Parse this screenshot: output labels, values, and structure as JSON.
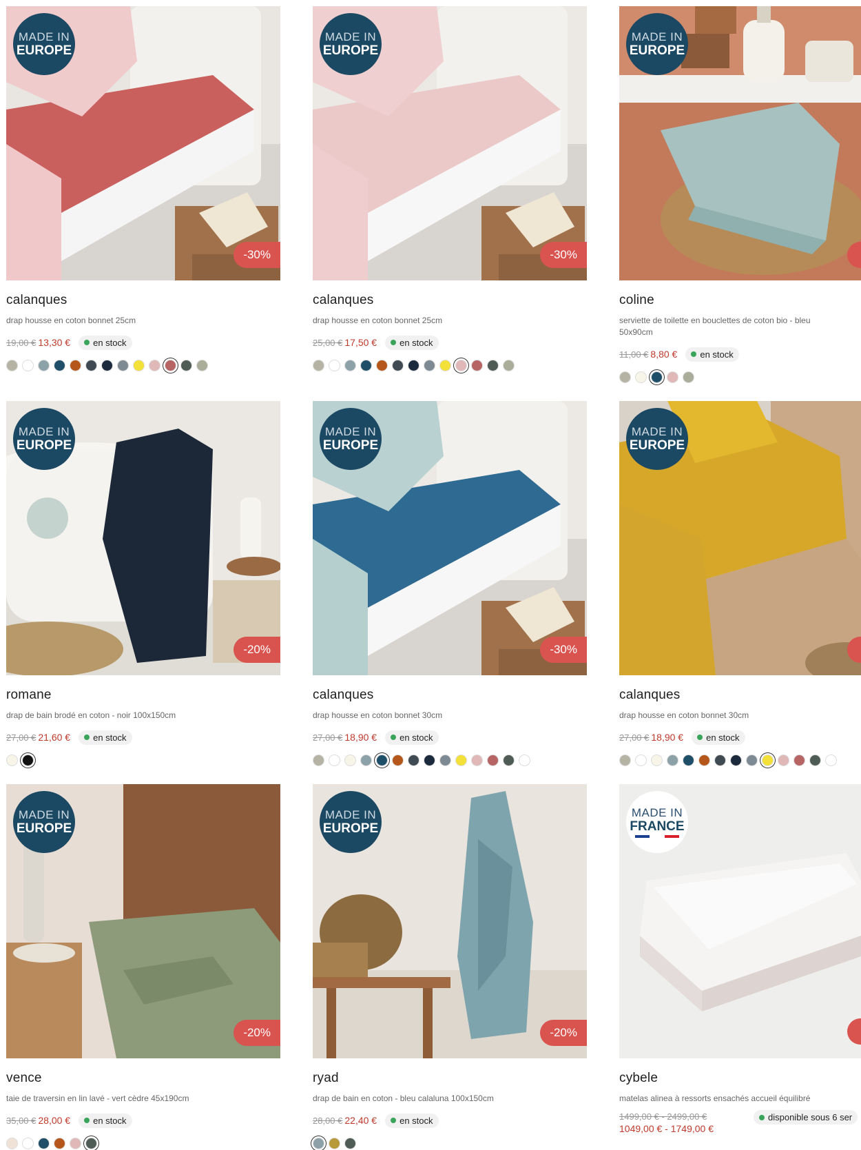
{
  "products": [
    {
      "id": "p1",
      "name": "calanques",
      "desc": "drap housse en coton bonnet 25cm",
      "old": "19,00 €",
      "new": "13,30 €",
      "stock": "en stock",
      "badge": {
        "l1": "MADE IN",
        "l2": "EUROPE"
      },
      "discount": "-30%",
      "swatches": [
        "#b5b3a3",
        "#ffffff",
        "#8da2a8",
        "#1f4e68",
        "#b5561a",
        "#3f4a52",
        "#1c2a3e",
        "#7e8a93",
        "#f3e13a",
        "#e0b8b8",
        "#b76464",
        "#4f5b55",
        "#a9ad9a"
      ],
      "selected": 10,
      "scene": "bed-red"
    },
    {
      "id": "p2",
      "name": "calanques",
      "desc": "drap housse en coton bonnet 25cm",
      "old": "25,00 €",
      "new": "17,50 €",
      "stock": "en stock",
      "badge": {
        "l1": "MADE IN",
        "l2": "EUROPE"
      },
      "discount": "-30%",
      "swatches": [
        "#b5b3a3",
        "#ffffff",
        "#8da2a8",
        "#1f4e68",
        "#b5561a",
        "#3f4a52",
        "#1c2a3e",
        "#7e8a93",
        "#f3e13a",
        "#e0b8b8",
        "#b76464",
        "#4f5b55",
        "#a9ad9a"
      ],
      "selected": 9,
      "scene": "bed-pink"
    },
    {
      "id": "p3",
      "name": "coline",
      "desc": "serviette de toilette en bouclettes de coton bio - bleu 50x90cm",
      "old": "11,00 €",
      "new": "8,80 €",
      "stock": "en stock",
      "badge": {
        "l1": "MADE IN",
        "l2": "EUROPE"
      },
      "discount": "",
      "swatches": [
        "#b5b3a3",
        "#f7f4e8",
        "#1f4e68",
        "#e0b8b8",
        "#a9ad9a"
      ],
      "selected": 2,
      "scene": "towel-blue"
    },
    {
      "id": "p4",
      "name": "romane",
      "desc": "drap de bain brodé en coton - noir 100x150cm",
      "old": "27,00 €",
      "new": "21,60 €",
      "stock": "en stock",
      "badge": {
        "l1": "MADE IN",
        "l2": "EUROPE"
      },
      "discount": "-20%",
      "swatches": [
        "#f7f4e8",
        "#111111"
      ],
      "selected": 1,
      "scene": "bath-black"
    },
    {
      "id": "p5",
      "name": "calanques",
      "desc": "drap housse en coton bonnet 30cm",
      "old": "27,00 €",
      "new": "18,90 €",
      "stock": "en stock",
      "badge": {
        "l1": "MADE IN",
        "l2": "EUROPE"
      },
      "discount": "-30%",
      "swatches": [
        "#b5b3a3",
        "#ffffff",
        "#f7f4e8",
        "#8da2a8",
        "#1f4e68",
        "#b5561a",
        "#3f4a52",
        "#1c2a3e",
        "#7e8a93",
        "#f3e13a",
        "#e0b8b8",
        "#b76464",
        "#4f5b55",
        "#ffffff"
      ],
      "selected": 4,
      "scene": "bed-blue"
    },
    {
      "id": "p6",
      "name": "calanques",
      "desc": "drap housse en coton bonnet 30cm",
      "old": "27,00 €",
      "new": "18,90 €",
      "stock": "en stock",
      "badge": {
        "l1": "MADE IN",
        "l2": "EUROPE"
      },
      "discount": "",
      "swatches": [
        "#b5b3a3",
        "#ffffff",
        "#f7f4e8",
        "#8da2a8",
        "#1f4e68",
        "#b5561a",
        "#3f4a52",
        "#1c2a3e",
        "#7e8a93",
        "#f3e13a",
        "#e0b8b8",
        "#b76464",
        "#4f5b55",
        "#ffffff"
      ],
      "selected": 9,
      "scene": "bed-yellow"
    },
    {
      "id": "p7",
      "name": "vence",
      "desc": "taie de traversin en lin lavé - vert cèdre 45x190cm",
      "old": "35,00 €",
      "new": "28,00 €",
      "stock": "en stock",
      "badge": {
        "l1": "MADE IN",
        "l2": "EUROPE"
      },
      "discount": "-20%",
      "swatches": [
        "#f0e2d6",
        "#ffffff",
        "#1f4e68",
        "#b5561a",
        "#e0b8b8",
        "#4f5b55"
      ],
      "selected": 5,
      "scene": "bed-green"
    },
    {
      "id": "p8",
      "name": "ryad",
      "desc": "drap de bain en coton - bleu calaluna 100x150cm",
      "old": "28,00 €",
      "new": "22,40 €",
      "stock": "en stock",
      "badge": {
        "l1": "MADE IN",
        "l2": "EUROPE"
      },
      "discount": "-20%",
      "swatches": [
        "#8da2a8",
        "#b89a3a",
        "#4f5b55"
      ],
      "selected": 0,
      "scene": "towel-hang"
    },
    {
      "id": "p9",
      "name": "cybele",
      "desc": "matelas alinea à ressorts ensachés accueil équilibré",
      "old": "1499,00 € - 2499,00 €",
      "new": "1049,00 € - 1749,00 €",
      "stock": "disponible sous 6 ser",
      "badge": {
        "l1": "MADE IN",
        "l2": "FRANCE"
      },
      "discount": "",
      "swatches": [],
      "selected": -1,
      "scene": "mattress"
    }
  ],
  "colors": {
    "badge_bg": "#1b4863",
    "discount_bg": "#d9534f",
    "price_new": "#c0392b",
    "stock_dot": "#3aa55a"
  }
}
